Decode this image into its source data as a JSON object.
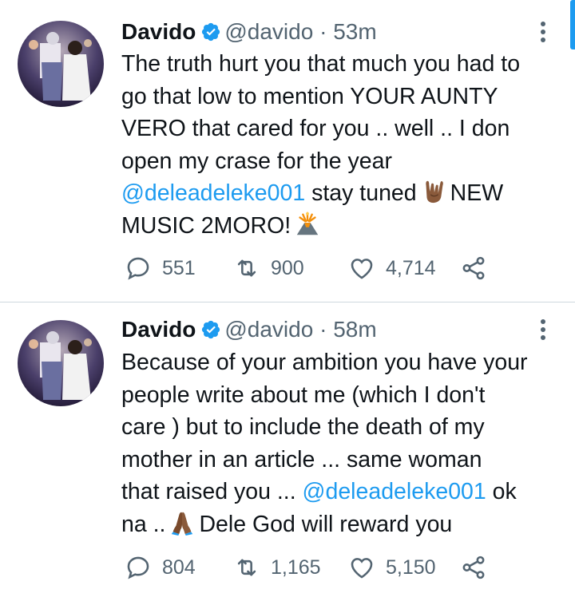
{
  "tweets": [
    {
      "author_name": "Davido",
      "handle": "@davido",
      "separator": "·",
      "time": "53m",
      "lines": [
        [
          "The truth hurt you that much you had to"
        ],
        [
          "go that low to mention YOUR AUNTY"
        ],
        [
          "VERO that cared for you .. well .. I don"
        ],
        [
          "open my crase for the year"
        ]
      ],
      "line5_mention": "@deleadeleke001",
      "line5_text": " stay tuned",
      "line5_after": "NEW",
      "line6_text": "MUSIC 2MORO!",
      "emoji_1": "horns-emoji",
      "emoji_2": "volcano-emoji",
      "replies": "551",
      "retweets": "900",
      "likes": "4,714"
    },
    {
      "author_name": "Davido",
      "handle": "@davido",
      "separator": "·",
      "time": "58m",
      "line1": "Because of your ambition you have your",
      "line2": "people write about me (which I don't",
      "line3": "care ) but to include the death of my",
      "line4": "mother in an article ... same woman",
      "line5_text": "that raised you ... ",
      "line5_mention": "@deleadeleke001",
      "line5_after": " ok",
      "line6_before": "na ..",
      "line6_after": "Dele God will  reward you",
      "emoji_1": "praying-hands-emoji",
      "replies": "804",
      "retweets": "1,165",
      "likes": "5,150"
    }
  ],
  "colors": {
    "accent": "#1d9bf0",
    "text": "#0f1419",
    "muted": "#536471",
    "divider": "#cfd9de"
  }
}
